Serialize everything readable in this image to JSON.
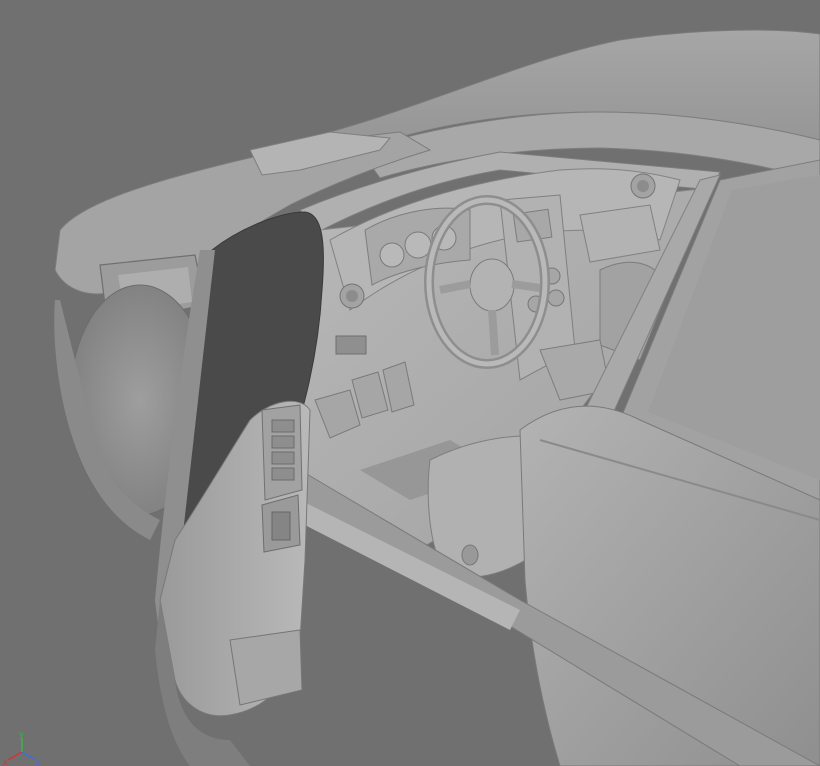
{
  "viewport": {
    "background": "#707070",
    "model_base_color": "#a9a9a9"
  },
  "axis_gizmo": {
    "x_label": "x",
    "y_label": "y",
    "z_label": "z",
    "x_color": "#d8332e",
    "y_color": "#39b54a",
    "z_color": "#3f6fd8"
  }
}
